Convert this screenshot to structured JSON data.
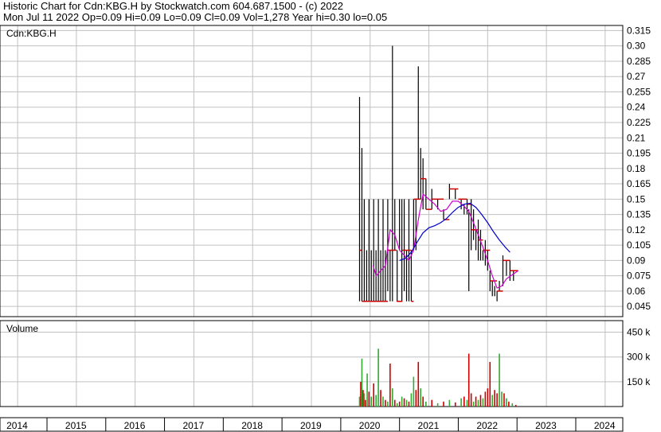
{
  "header": {
    "line1": "Historic Chart for Cdn:KBG.H by Stockwatch.com 604.687.1500 - (c) 2022",
    "line2": "Mon Jul 11 2022  Op=0.09  Hi=0.09  Lo=0.09  Cl=0.09  Vol=1,278  Year hi=0.30  lo=0.05"
  },
  "chart_data": {
    "type": "line",
    "symbol_label": "Cdn:KBG.H",
    "volume_label": "Volume",
    "price_axis": {
      "ticks": [
        "0.315",
        "0.30",
        "0.285",
        "0.27",
        "0.255",
        "0.24",
        "0.225",
        "0.21",
        "0.195",
        "0.18",
        "0.165",
        "0.15",
        "0.135",
        "0.12",
        "0.105",
        "0.09",
        "0.075",
        "0.06",
        "0.045"
      ],
      "ylim": [
        0.035,
        0.32
      ]
    },
    "volume_axis": {
      "ticks": [
        "450 k",
        "300 k",
        "150 k"
      ],
      "tick_values": [
        450000,
        300000,
        150000
      ],
      "ylim": [
        0,
        520000
      ]
    },
    "x_axis": {
      "labels": [
        "2014",
        "2015",
        "2016",
        "2017",
        "2018",
        "2019",
        "2020",
        "2021",
        "2022",
        "2023",
        "2024"
      ],
      "xlim": [
        2013.7,
        2024.3
      ]
    },
    "colors": {
      "price": "#000000",
      "ma_short": "#cc00cc",
      "ma_long": "#0000cc",
      "close_marks": "#cc0000",
      "volume_up": "#33aa33",
      "volume_down": "#cc0000",
      "grid": "#c0c0c0"
    },
    "price_bars": [
      {
        "t": 2019.82,
        "hi": 0.25,
        "lo": 0.05
      },
      {
        "t": 2019.86,
        "hi": 0.2,
        "lo": 0.05
      },
      {
        "t": 2019.9,
        "hi": 0.15,
        "lo": 0.05
      },
      {
        "t": 2019.94,
        "hi": 0.1,
        "lo": 0.05
      },
      {
        "t": 2019.98,
        "hi": 0.15,
        "lo": 0.05
      },
      {
        "t": 2020.02,
        "hi": 0.1,
        "lo": 0.05
      },
      {
        "t": 2020.06,
        "hi": 0.15,
        "lo": 0.05
      },
      {
        "t": 2020.1,
        "hi": 0.1,
        "lo": 0.05
      },
      {
        "t": 2020.14,
        "hi": 0.15,
        "lo": 0.05
      },
      {
        "t": 2020.18,
        "hi": 0.1,
        "lo": 0.05
      },
      {
        "t": 2020.22,
        "hi": 0.15,
        "lo": 0.05
      },
      {
        "t": 2020.26,
        "hi": 0.1,
        "lo": 0.05
      },
      {
        "t": 2020.3,
        "hi": 0.15,
        "lo": 0.06
      },
      {
        "t": 2020.34,
        "hi": 0.1,
        "lo": 0.05
      },
      {
        "t": 2020.38,
        "hi": 0.3,
        "lo": 0.05
      },
      {
        "t": 2020.42,
        "hi": 0.15,
        "lo": 0.1
      },
      {
        "t": 2020.46,
        "hi": 0.1,
        "lo": 0.05
      },
      {
        "t": 2020.5,
        "hi": 0.15,
        "lo": 0.1
      },
      {
        "t": 2020.54,
        "hi": 0.15,
        "lo": 0.05
      },
      {
        "t": 2020.58,
        "hi": 0.15,
        "lo": 0.06
      },
      {
        "t": 2020.62,
        "hi": 0.1,
        "lo": 0.05
      },
      {
        "t": 2020.66,
        "hi": 0.15,
        "lo": 0.05
      },
      {
        "t": 2020.7,
        "hi": 0.1,
        "lo": 0.05
      },
      {
        "t": 2020.74,
        "hi": 0.15,
        "lo": 0.1
      },
      {
        "t": 2020.78,
        "hi": 0.15,
        "lo": 0.1
      },
      {
        "t": 2020.82,
        "hi": 0.28,
        "lo": 0.15
      },
      {
        "t": 2020.86,
        "hi": 0.2,
        "lo": 0.15
      },
      {
        "t": 2020.9,
        "hi": 0.19,
        "lo": 0.14
      },
      {
        "t": 2020.95,
        "hi": 0.17,
        "lo": 0.14
      },
      {
        "t": 2021.05,
        "hi": 0.16,
        "lo": 0.14
      },
      {
        "t": 2021.15,
        "hi": 0.15,
        "lo": 0.14
      },
      {
        "t": 2021.25,
        "hi": 0.14,
        "lo": 0.13
      },
      {
        "t": 2021.35,
        "hi": 0.165,
        "lo": 0.15
      },
      {
        "t": 2021.45,
        "hi": 0.16,
        "lo": 0.15
      },
      {
        "t": 2021.55,
        "hi": 0.15,
        "lo": 0.14
      },
      {
        "t": 2021.6,
        "hi": 0.145,
        "lo": 0.135
      },
      {
        "t": 2021.65,
        "hi": 0.15,
        "lo": 0.135
      },
      {
        "t": 2021.68,
        "hi": 0.14,
        "lo": 0.06
      },
      {
        "t": 2021.72,
        "hi": 0.15,
        "lo": 0.1
      },
      {
        "t": 2021.76,
        "hi": 0.14,
        "lo": 0.11
      },
      {
        "t": 2021.8,
        "hi": 0.12,
        "lo": 0.1
      },
      {
        "t": 2021.84,
        "hi": 0.13,
        "lo": 0.09
      },
      {
        "t": 2021.88,
        "hi": 0.12,
        "lo": 0.09
      },
      {
        "t": 2021.92,
        "hi": 0.1,
        "lo": 0.09
      },
      {
        "t": 2021.96,
        "hi": 0.11,
        "lo": 0.085
      },
      {
        "t": 2022.0,
        "hi": 0.1,
        "lo": 0.08
      },
      {
        "t": 2022.04,
        "hi": 0.08,
        "lo": 0.06
      },
      {
        "t": 2022.08,
        "hi": 0.07,
        "lo": 0.055
      },
      {
        "t": 2022.12,
        "hi": 0.065,
        "lo": 0.055
      },
      {
        "t": 2022.16,
        "hi": 0.06,
        "lo": 0.05
      },
      {
        "t": 2022.2,
        "hi": 0.07,
        "lo": 0.06
      },
      {
        "t": 2022.26,
        "hi": 0.095,
        "lo": 0.065
      },
      {
        "t": 2022.32,
        "hi": 0.09,
        "lo": 0.075
      },
      {
        "t": 2022.38,
        "hi": 0.09,
        "lo": 0.07
      },
      {
        "t": 2022.44,
        "hi": 0.08,
        "lo": 0.07
      },
      {
        "t": 2022.52,
        "hi": 0.09,
        "lo": 0.09
      }
    ],
    "close_steps": [
      {
        "t": 2019.82,
        "v": 0.1
      },
      {
        "t": 2019.86,
        "v": 0.05
      },
      {
        "t": 2020.0,
        "v": 0.05
      },
      {
        "t": 2020.1,
        "v": 0.05
      },
      {
        "t": 2020.3,
        "v": 0.1
      },
      {
        "t": 2020.45,
        "v": 0.05
      },
      {
        "t": 2020.55,
        "v": 0.1
      },
      {
        "t": 2020.7,
        "v": 0.05
      },
      {
        "t": 2020.74,
        "v": 0.15
      },
      {
        "t": 2020.86,
        "v": 0.17
      },
      {
        "t": 2020.95,
        "v": 0.14
      },
      {
        "t": 2021.05,
        "v": 0.15
      },
      {
        "t": 2021.25,
        "v": 0.13
      },
      {
        "t": 2021.35,
        "v": 0.16
      },
      {
        "t": 2021.5,
        "v": 0.15
      },
      {
        "t": 2021.65,
        "v": 0.145
      },
      {
        "t": 2021.72,
        "v": 0.12
      },
      {
        "t": 2021.84,
        "v": 0.11
      },
      {
        "t": 2021.92,
        "v": 0.1
      },
      {
        "t": 2022.04,
        "v": 0.07
      },
      {
        "t": 2022.16,
        "v": 0.06
      },
      {
        "t": 2022.26,
        "v": 0.09
      },
      {
        "t": 2022.38,
        "v": 0.08
      },
      {
        "t": 2022.52,
        "v": 0.09
      }
    ],
    "ma_short": [
      {
        "t": 2020.05,
        "v": 0.085
      },
      {
        "t": 2020.1,
        "v": 0.075
      },
      {
        "t": 2020.18,
        "v": 0.08
      },
      {
        "t": 2020.26,
        "v": 0.085
      },
      {
        "t": 2020.34,
        "v": 0.12
      },
      {
        "t": 2020.42,
        "v": 0.115
      },
      {
        "t": 2020.5,
        "v": 0.1
      },
      {
        "t": 2020.58,
        "v": 0.095
      },
      {
        "t": 2020.66,
        "v": 0.09
      },
      {
        "t": 2020.74,
        "v": 0.1
      },
      {
        "t": 2020.82,
        "v": 0.13
      },
      {
        "t": 2020.9,
        "v": 0.155
      },
      {
        "t": 2021.0,
        "v": 0.15
      },
      {
        "t": 2021.1,
        "v": 0.145
      },
      {
        "t": 2021.2,
        "v": 0.138
      },
      {
        "t": 2021.3,
        "v": 0.14
      },
      {
        "t": 2021.4,
        "v": 0.148
      },
      {
        "t": 2021.5,
        "v": 0.148
      },
      {
        "t": 2021.6,
        "v": 0.143
      },
      {
        "t": 2021.68,
        "v": 0.138
      },
      {
        "t": 2021.76,
        "v": 0.127
      },
      {
        "t": 2021.84,
        "v": 0.115
      },
      {
        "t": 2021.92,
        "v": 0.103
      },
      {
        "t": 2022.0,
        "v": 0.09
      },
      {
        "t": 2022.08,
        "v": 0.075
      },
      {
        "t": 2022.16,
        "v": 0.063
      },
      {
        "t": 2022.24,
        "v": 0.065
      },
      {
        "t": 2022.32,
        "v": 0.072
      },
      {
        "t": 2022.42,
        "v": 0.076
      },
      {
        "t": 2022.52,
        "v": 0.08
      }
    ],
    "ma_long": [
      {
        "t": 2020.5,
        "v": 0.09
      },
      {
        "t": 2020.6,
        "v": 0.092
      },
      {
        "t": 2020.7,
        "v": 0.098
      },
      {
        "t": 2020.8,
        "v": 0.108
      },
      {
        "t": 2020.9,
        "v": 0.117
      },
      {
        "t": 2021.0,
        "v": 0.122
      },
      {
        "t": 2021.1,
        "v": 0.124
      },
      {
        "t": 2021.2,
        "v": 0.127
      },
      {
        "t": 2021.3,
        "v": 0.131
      },
      {
        "t": 2021.4,
        "v": 0.137
      },
      {
        "t": 2021.5,
        "v": 0.142
      },
      {
        "t": 2021.6,
        "v": 0.145
      },
      {
        "t": 2021.7,
        "v": 0.146
      },
      {
        "t": 2021.8,
        "v": 0.142
      },
      {
        "t": 2021.9,
        "v": 0.135
      },
      {
        "t": 2022.0,
        "v": 0.127
      },
      {
        "t": 2022.1,
        "v": 0.118
      },
      {
        "t": 2022.2,
        "v": 0.11
      },
      {
        "t": 2022.3,
        "v": 0.103
      },
      {
        "t": 2022.38,
        "v": 0.098
      }
    ],
    "volume_bars": [
      {
        "t": 2019.82,
        "v": 60000,
        "dir": "up"
      },
      {
        "t": 2019.84,
        "v": 150000,
        "dir": "down"
      },
      {
        "t": 2019.86,
        "v": 290000,
        "dir": "up"
      },
      {
        "t": 2019.88,
        "v": 100000,
        "dir": "down"
      },
      {
        "t": 2019.9,
        "v": 80000,
        "dir": "up"
      },
      {
        "t": 2019.92,
        "v": 40000,
        "dir": "down"
      },
      {
        "t": 2019.95,
        "v": 200000,
        "dir": "up"
      },
      {
        "t": 2019.98,
        "v": 90000,
        "dir": "down"
      },
      {
        "t": 2020.02,
        "v": 60000,
        "dir": "up"
      },
      {
        "t": 2020.06,
        "v": 140000,
        "dir": "down"
      },
      {
        "t": 2020.1,
        "v": 70000,
        "dir": "up"
      },
      {
        "t": 2020.14,
        "v": 350000,
        "dir": "up"
      },
      {
        "t": 2020.18,
        "v": 100000,
        "dir": "down"
      },
      {
        "t": 2020.22,
        "v": 60000,
        "dir": "up"
      },
      {
        "t": 2020.26,
        "v": 40000,
        "dir": "down"
      },
      {
        "t": 2020.3,
        "v": 30000,
        "dir": "up"
      },
      {
        "t": 2020.34,
        "v": 260000,
        "dir": "down"
      },
      {
        "t": 2020.38,
        "v": 110000,
        "dir": "up"
      },
      {
        "t": 2020.42,
        "v": 40000,
        "dir": "down"
      },
      {
        "t": 2020.46,
        "v": 20000,
        "dir": "up"
      },
      {
        "t": 2020.5,
        "v": 30000,
        "dir": "down"
      },
      {
        "t": 2020.54,
        "v": 60000,
        "dir": "up"
      },
      {
        "t": 2020.58,
        "v": 50000,
        "dir": "down"
      },
      {
        "t": 2020.62,
        "v": 40000,
        "dir": "up"
      },
      {
        "t": 2020.66,
        "v": 30000,
        "dir": "down"
      },
      {
        "t": 2020.7,
        "v": 80000,
        "dir": "up"
      },
      {
        "t": 2020.74,
        "v": 180000,
        "dir": "up"
      },
      {
        "t": 2020.78,
        "v": 100000,
        "dir": "down"
      },
      {
        "t": 2020.82,
        "v": 270000,
        "dir": "down"
      },
      {
        "t": 2020.86,
        "v": 110000,
        "dir": "up"
      },
      {
        "t": 2020.9,
        "v": 60000,
        "dir": "down"
      },
      {
        "t": 2020.95,
        "v": 30000,
        "dir": "up"
      },
      {
        "t": 2021.05,
        "v": 40000,
        "dir": "down"
      },
      {
        "t": 2021.15,
        "v": 20000,
        "dir": "up"
      },
      {
        "t": 2021.25,
        "v": 30000,
        "dir": "down"
      },
      {
        "t": 2021.35,
        "v": 40000,
        "dir": "up"
      },
      {
        "t": 2021.45,
        "v": 25000,
        "dir": "down"
      },
      {
        "t": 2021.55,
        "v": 50000,
        "dir": "up"
      },
      {
        "t": 2021.6,
        "v": 60000,
        "dir": "down"
      },
      {
        "t": 2021.65,
        "v": 40000,
        "dir": "up"
      },
      {
        "t": 2021.68,
        "v": 320000,
        "dir": "down"
      },
      {
        "t": 2021.72,
        "v": 80000,
        "dir": "down"
      },
      {
        "t": 2021.76,
        "v": 30000,
        "dir": "up"
      },
      {
        "t": 2021.8,
        "v": 60000,
        "dir": "down"
      },
      {
        "t": 2021.84,
        "v": 40000,
        "dir": "up"
      },
      {
        "t": 2021.88,
        "v": 70000,
        "dir": "down"
      },
      {
        "t": 2021.92,
        "v": 50000,
        "dir": "up"
      },
      {
        "t": 2021.96,
        "v": 90000,
        "dir": "down"
      },
      {
        "t": 2022.0,
        "v": 110000,
        "dir": "down"
      },
      {
        "t": 2022.04,
        "v": 270000,
        "dir": "down"
      },
      {
        "t": 2022.08,
        "v": 70000,
        "dir": "up"
      },
      {
        "t": 2022.12,
        "v": 100000,
        "dir": "down"
      },
      {
        "t": 2022.16,
        "v": 80000,
        "dir": "down"
      },
      {
        "t": 2022.2,
        "v": 320000,
        "dir": "up"
      },
      {
        "t": 2022.24,
        "v": 90000,
        "dir": "up"
      },
      {
        "t": 2022.28,
        "v": 80000,
        "dir": "down"
      },
      {
        "t": 2022.32,
        "v": 50000,
        "dir": "up"
      },
      {
        "t": 2022.36,
        "v": 30000,
        "dir": "down"
      },
      {
        "t": 2022.42,
        "v": 20000,
        "dir": "up"
      },
      {
        "t": 2022.48,
        "v": 10000,
        "dir": "down"
      }
    ]
  }
}
